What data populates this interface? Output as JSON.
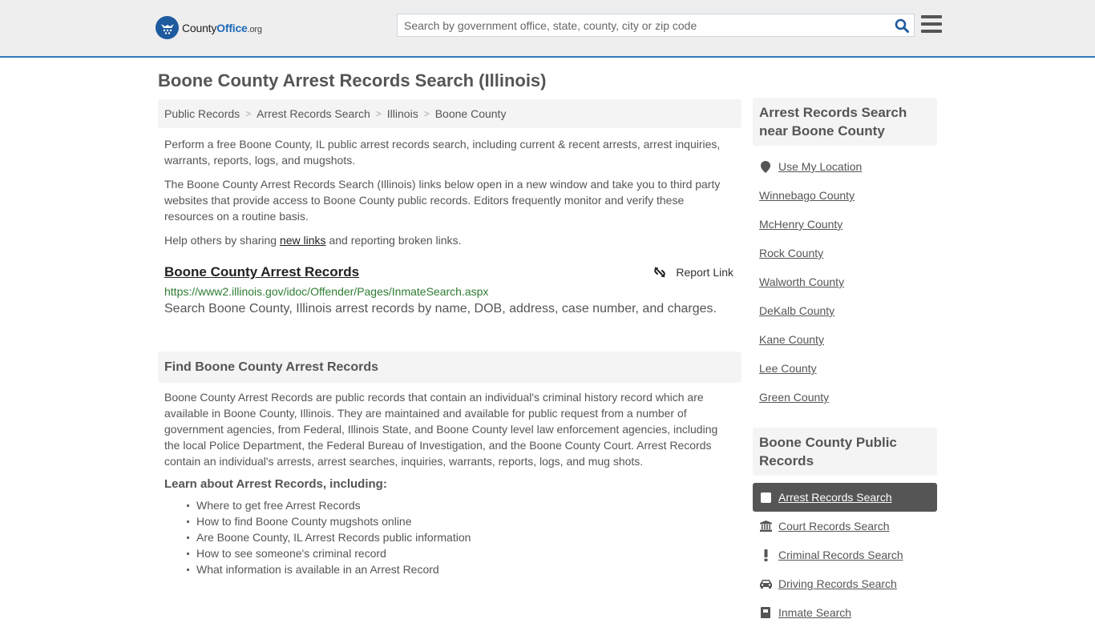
{
  "header": {
    "logo": {
      "county": "County",
      "office": "Office",
      "org": ".org"
    },
    "search_placeholder": "Search by government office, state, county, city or zip code",
    "search_icon": "search-icon",
    "menu_icon": "hamburger-menu-icon",
    "accent_color": "#2f7bbf"
  },
  "page_title": "Boone County Arrest Records Search (Illinois)",
  "breadcrumb": [
    {
      "label": "Public Records"
    },
    {
      "label": "Arrest Records Search"
    },
    {
      "label": "Illinois"
    },
    {
      "label": "Boone County"
    }
  ],
  "intro": {
    "p1": "Perform a free Boone County, IL public arrest records search, including current & recent arrests, arrest inquiries, warrants, reports, logs, and mugshots.",
    "p2": "The Boone County Arrest Records Search (Illinois) links below open in a new window and take you to third party websites that provide access to Boone County public records. Editors frequently monitor and verify these resources on a routine basis.",
    "p3_before": "Help others by sharing ",
    "p3_link": "new links",
    "p3_after": " and reporting broken links."
  },
  "result": {
    "title": "Boone County Arrest Records",
    "report_label": "Report Link",
    "url": "https://www2.illinois.gov/idoc/Offender/Pages/InmateSearch.aspx",
    "description": "Search Boone County, Illinois arrest records by name, DOB, address, case number, and charges."
  },
  "find_section": {
    "heading": "Find Boone County Arrest Records",
    "body": "Boone County Arrest Records are public records that contain an individual's criminal history record which are available in Boone County, Illinois. They are maintained and available for public request from a number of government agencies, from Federal, Illinois State, and Boone County level law enforcement agencies, including the local Police Department, the Federal Bureau of Investigation, and the Boone County Court. Arrest Records contain an individual's arrests, arrest searches, inquiries, warrants, reports, logs, and mug shots.",
    "learn_heading": "Learn about Arrest Records, including:",
    "learn_items": [
      "Where to get free Arrest Records",
      "How to find Boone County mugshots online",
      "Are Boone County, IL Arrest Records public information",
      "How to see someone's criminal record",
      "What information is available in an Arrest Record"
    ]
  },
  "sidebar": {
    "near_heading": "Arrest Records Search near Boone County",
    "use_location": "Use My Location",
    "near_items": [
      "Winnebago County",
      "McHenry County",
      "Rock County",
      "Walworth County",
      "DeKalb County",
      "Kane County",
      "Lee County",
      "Green County"
    ],
    "public_heading": "Boone County Public Records",
    "public_items": [
      {
        "label": "Arrest Records Search",
        "icon": "square-icon",
        "active": true
      },
      {
        "label": "Court Records Search",
        "icon": "courthouse-icon",
        "active": false
      },
      {
        "label": "Criminal Records Search",
        "icon": "exclamation-icon",
        "active": false
      },
      {
        "label": "Driving Records Search",
        "icon": "car-icon",
        "active": false
      },
      {
        "label": "Inmate Search",
        "icon": "inmate-icon",
        "active": false
      }
    ]
  }
}
